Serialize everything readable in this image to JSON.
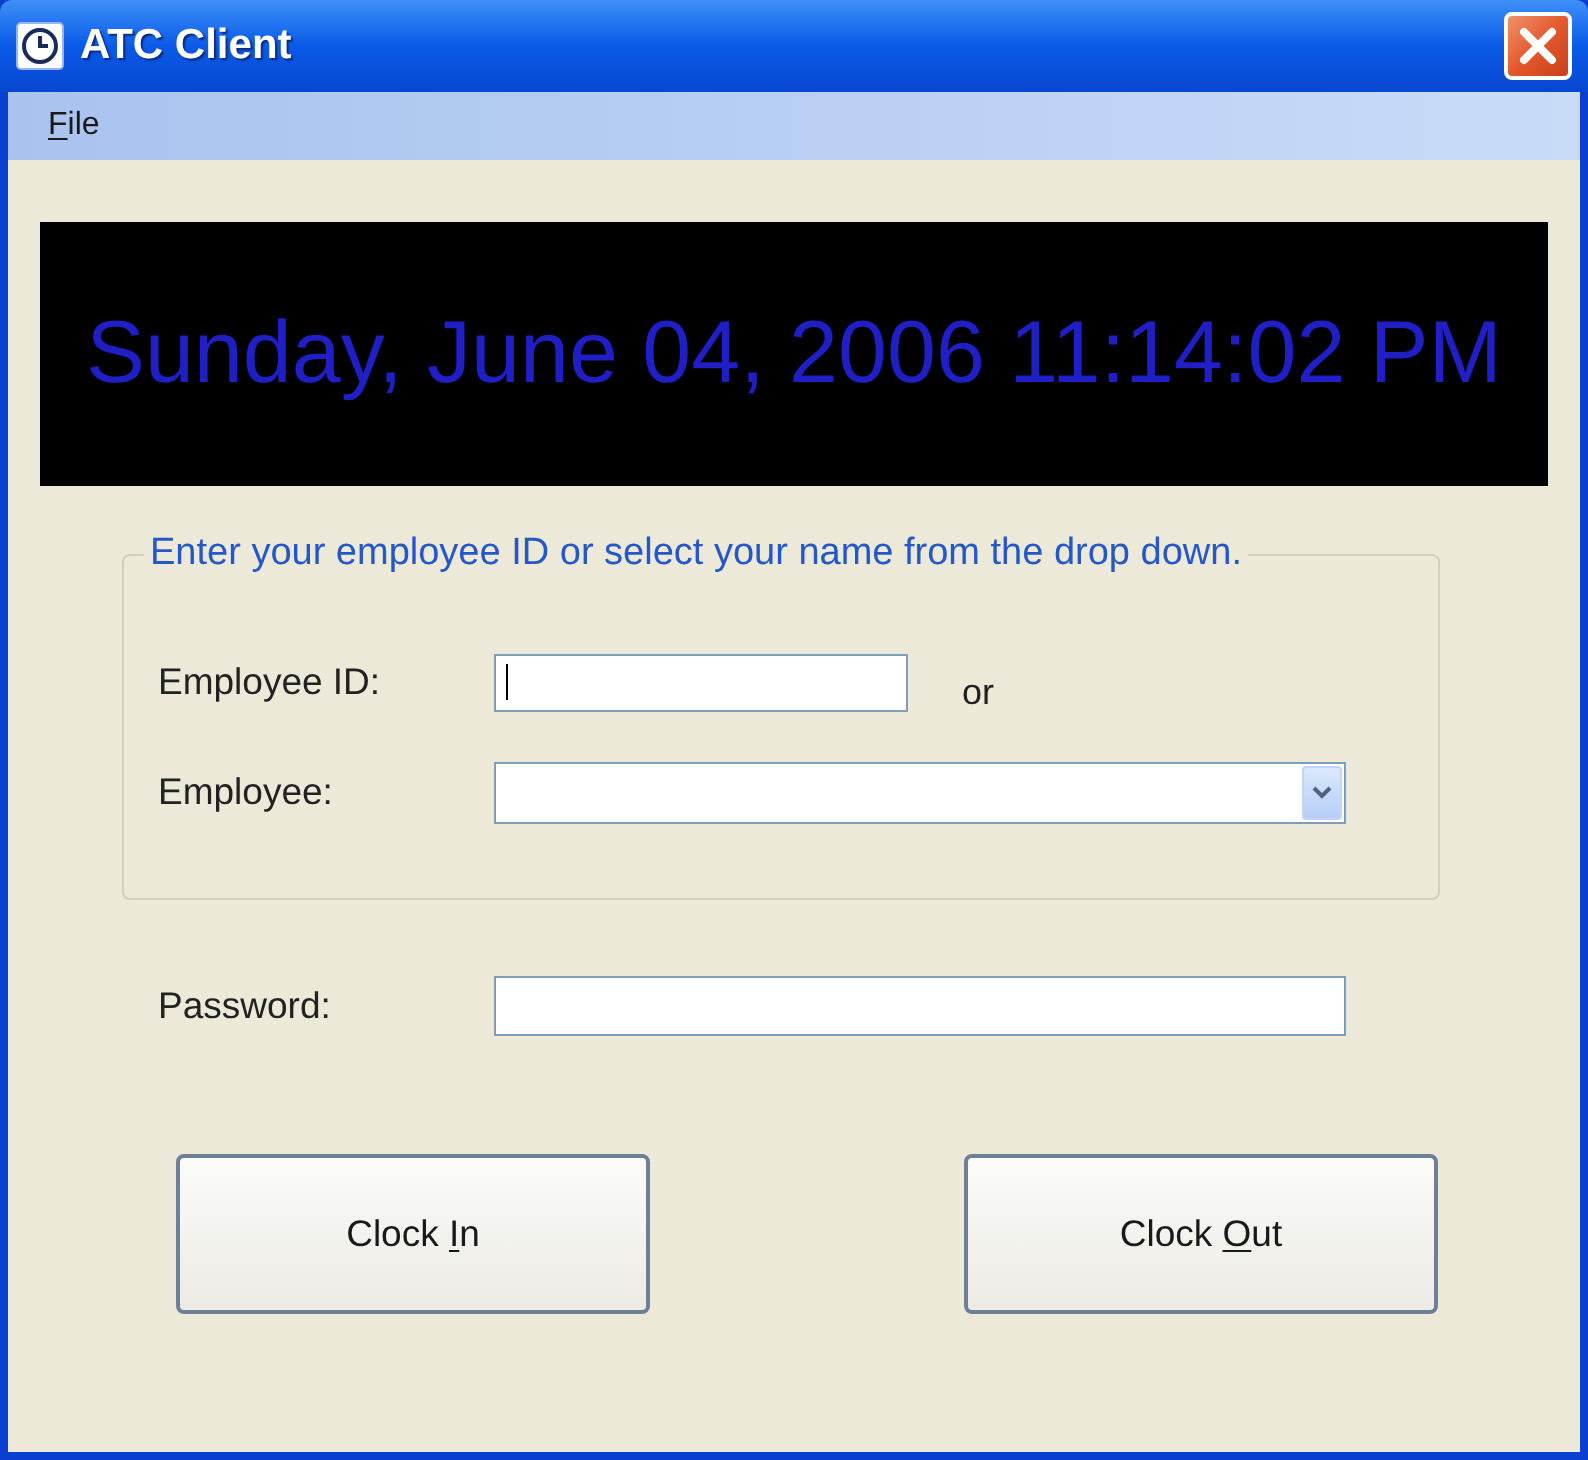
{
  "window": {
    "title": "ATC Client"
  },
  "menu": [
    {
      "parts": [
        {
          "text": "F",
          "underlined": true
        },
        {
          "text": "ile",
          "underlined": false
        }
      ]
    }
  ],
  "clock": {
    "text": "Sunday, June 04, 2006 11:14:02 PM"
  },
  "employee_group": {
    "legend": "Enter your employee ID or select your name from the drop down.",
    "fields": [
      {
        "kind": "text",
        "label": "Employee ID:",
        "focused": true,
        "after": "or"
      },
      {
        "kind": "dropdown",
        "label": "Employee:",
        "focused": false
      }
    ]
  },
  "password": {
    "label": "Password:"
  },
  "buttons": [
    {
      "parts": [
        {
          "text": "Clock ",
          "underlined": false
        },
        {
          "text": "I",
          "underlined": true
        },
        {
          "text": "n",
          "underlined": false
        }
      ]
    },
    {
      "parts": [
        {
          "text": "Clock ",
          "underlined": false
        },
        {
          "text": "O",
          "underlined": true
        },
        {
          "text": "ut",
          "underlined": false
        }
      ]
    }
  ]
}
